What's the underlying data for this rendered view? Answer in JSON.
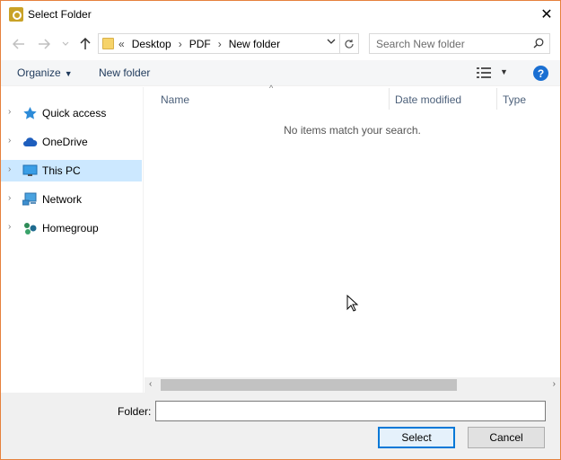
{
  "window": {
    "title": "Select Folder",
    "close_glyph": "✕",
    "border_color": "#e6813d"
  },
  "navigation": {
    "back_icon": "back-arrow-icon",
    "forward_icon": "forward-arrow-icon",
    "recent_icon": "chevron-down-icon",
    "up_icon": "up-arrow-icon"
  },
  "address": {
    "overflow": "«",
    "crumbs": [
      "Desktop",
      "PDF",
      "New folder"
    ],
    "separator": "›"
  },
  "search": {
    "placeholder": "Search New folder"
  },
  "toolbar": {
    "organize_label": "Organize",
    "new_folder_label": "New folder",
    "help_label": "?"
  },
  "nav_pane": {
    "items": [
      {
        "label": "Quick access",
        "icon": "star-icon",
        "selected": false
      },
      {
        "label": "OneDrive",
        "icon": "cloud-icon",
        "selected": false
      },
      {
        "label": "This PC",
        "icon": "monitor-icon",
        "selected": true
      },
      {
        "label": "Network",
        "icon": "network-icon",
        "selected": false
      },
      {
        "label": "Homegroup",
        "icon": "homegroup-icon",
        "selected": false
      }
    ]
  },
  "file_list": {
    "columns": [
      "Name",
      "Date modified",
      "Type"
    ],
    "empty_message": "No items match your search."
  },
  "footer": {
    "folder_label": "Folder:",
    "folder_value": "",
    "select_label": "Select",
    "cancel_label": "Cancel"
  },
  "colors": {
    "accent": "#0078d7",
    "selection": "#cce8ff",
    "link": "#1e395b"
  }
}
